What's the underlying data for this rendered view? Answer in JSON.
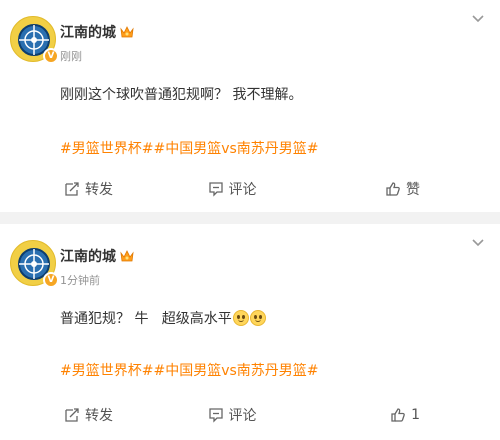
{
  "posts": [
    {
      "username": "江南的城",
      "timestamp": "刚刚",
      "content": "刚刚这个球吹普通犯规啊？ 我不理解。",
      "emojis": 0,
      "tags": [
        "#男篮世界杯#",
        "#中国男篮vs南苏丹男篮#"
      ],
      "repost_label": "转发",
      "comment_label": "评论",
      "like_label": "赞"
    },
    {
      "username": "江南的城",
      "timestamp": "1分钟前",
      "content": "普通犯规？ 牛   超级高水平",
      "emojis": 2,
      "tags": [
        "#男篮世界杯#",
        "#中国男篮vs南苏丹男篮#"
      ],
      "repost_label": "转发",
      "comment_label": "评论",
      "like_label": "1"
    }
  ],
  "colors": {
    "accent": "#ff8200",
    "avatar": "#f1cf45",
    "verified_badge": "#f6a623",
    "background": "#f2f2f2"
  },
  "icons": {
    "more": "chevron-down-icon",
    "repost": "repost-icon",
    "comment": "comment-icon",
    "like": "thumbs-up-icon",
    "badge": "crown-icon",
    "verified": "verified-badge-icon",
    "emoji": "smile-emoji-icon"
  }
}
